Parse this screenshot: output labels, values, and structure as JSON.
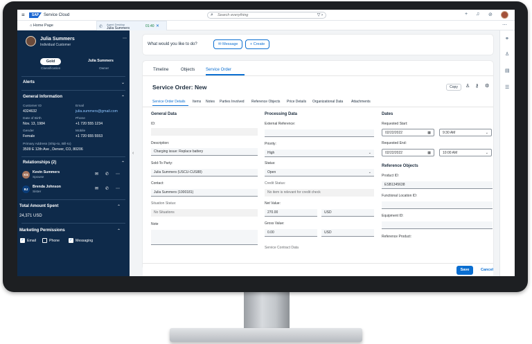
{
  "shell": {
    "product": "Service Cloud",
    "search_placeholder": "Search everything"
  },
  "tabs": {
    "home": "Home Page",
    "agent_desktop": "Agent Desktop",
    "agent_name": "Julia Summers",
    "timer": "01:40"
  },
  "customer": {
    "name": "Julia Summers",
    "type": "Individual Customer",
    "classification_value": "Gold",
    "classification_label": "Classification",
    "owner_value": "Julia Summers",
    "owner_label": "Owner"
  },
  "sidebar": {
    "alerts": "Alerts",
    "general": "General Information",
    "fields": [
      {
        "label": "Customer ID",
        "value": "4324632"
      },
      {
        "label": "Email",
        "value": "julia.summers@gmail.com"
      },
      {
        "label": "Date of Birth",
        "value": "Nov. 13, 1984"
      },
      {
        "label": "Phone",
        "value": "+1 720 555 1234"
      },
      {
        "label": "Gender",
        "value": "Female"
      },
      {
        "label": "Mobile",
        "value": "+1 720 655 5553"
      }
    ],
    "address_label": "Primary Address (Ship-to, Bill-to)",
    "address_value": "3509 E 12th Ave , Denver, CO, 80206",
    "relationships": "Relationships (2)",
    "rel": [
      {
        "initials": "KS",
        "name": "Kevin Summers",
        "role": "Spouse"
      },
      {
        "initials": "BJ",
        "name": "Brenda Johnson",
        "role": "Sister"
      }
    ],
    "total_label": "Total Amount Spent",
    "total_value": "24,371 USD",
    "marketing": "Marketing Permissions",
    "perms": [
      "Email",
      "Phone",
      "Messaging"
    ]
  },
  "actions": {
    "question": "What would you like to do?",
    "message": "Message",
    "create": "+ Create"
  },
  "main_tabs": [
    "Timeline",
    "Objects",
    "Service Order"
  ],
  "order": {
    "title": "Service Order: New",
    "copy": "Copy"
  },
  "sub_tabs": [
    "Service Order Details",
    "Items",
    "Notes",
    "Parties Involved",
    "Reference Objects",
    "Price Details",
    "Organizational Data",
    "Attachments"
  ],
  "general_data": {
    "heading": "General Data",
    "id_label": "ID:",
    "desc_label": "Description:",
    "desc_value": "Charging issue: Replace battery",
    "sold_label": "Sold-To Party:",
    "sold_value": "Julia Summers (USCU-CUS88)",
    "contact_label": "Contact:",
    "contact_value": "Julia Summers (1000181)",
    "situation_label": "Situation Status:",
    "situation_value": "No Situations",
    "note_label": "Note"
  },
  "processing": {
    "heading": "Processing Data",
    "ext_label": "External Reference:",
    "priority_label": "Priority:",
    "priority_value": "High",
    "status_label": "Status:",
    "status_value": "Open",
    "credit_label": "Credit Status:",
    "credit_value": "No item is relevant for credit check",
    "net_label": "Net Value:",
    "net_value": "270.00",
    "net_cur": "USD",
    "gross_label": "Gross Value:",
    "gross_value": "0.00",
    "gross_cur": "USD",
    "contract_label": "Service Contract Data"
  },
  "dates": {
    "heading": "Dates",
    "req_start_label": "Requested Start:",
    "req_start_date": "02/22/2022",
    "req_start_time": "9:30 AM",
    "req_end_label": "Requested End:",
    "req_end_date": "02/22/2022",
    "req_end_time": "10:00 AM"
  },
  "refobj": {
    "heading": "Reference Objects",
    "product_label": "Product ID:",
    "product_value": "ESB1345638",
    "fl_label": "Functional Location ID:",
    "eq_label": "Equipment ID:",
    "ref_label": "Reference Product:"
  },
  "footer": {
    "save": "Save",
    "cancel": "Cancel"
  }
}
